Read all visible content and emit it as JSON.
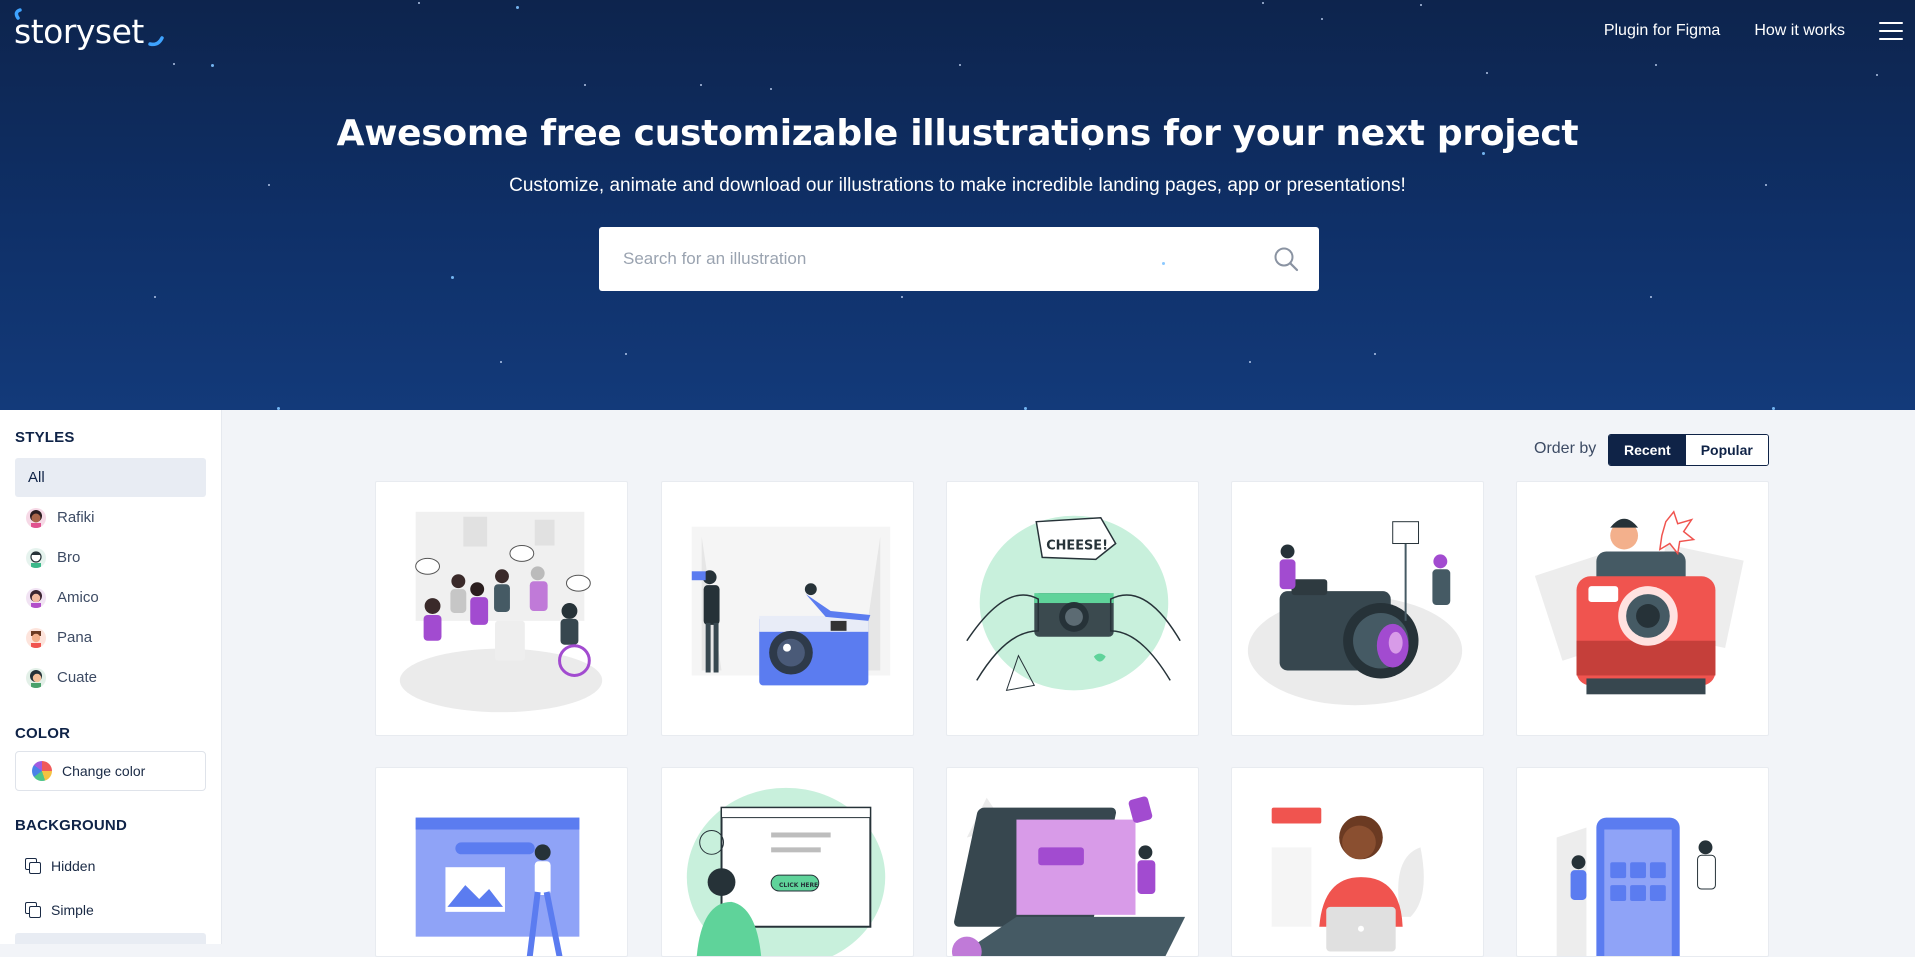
{
  "header": {
    "logo": "storyset",
    "nav": [
      "Plugin for Figma",
      "How it works"
    ]
  },
  "hero": {
    "title": "Awesome free customizable illustrations for your next project",
    "subtitle": "Customize, animate and download our illustrations to make incredible landing pages, app or presentations!",
    "search_placeholder": "Search for an illustration"
  },
  "sidebar": {
    "styles_title": "STYLES",
    "styles": [
      {
        "label": "All",
        "active": true
      },
      {
        "label": "Rafiki"
      },
      {
        "label": "Bro"
      },
      {
        "label": "Amico"
      },
      {
        "label": "Pana"
      },
      {
        "label": "Cuate"
      }
    ],
    "color_title": "COLOR",
    "change_color": "Change color",
    "background_title": "BACKGROUND",
    "backgrounds": [
      "Hidden",
      "Simple"
    ]
  },
  "order": {
    "label": "Order by",
    "options": [
      "Recent",
      "Popular"
    ],
    "selected": "Recent"
  },
  "cards": [
    {
      "name": "group-meeting-illustration"
    },
    {
      "name": "photographer-studio-illustration"
    },
    {
      "name": "cheese-camera-illustration"
    },
    {
      "name": "camera-photoshoot-illustration"
    },
    {
      "name": "instant-camera-illustration"
    },
    {
      "name": "click-here-presentation-illustration"
    },
    {
      "name": "click-here-browser-illustration"
    },
    {
      "name": "click-here-laptop-illustration"
    },
    {
      "name": "click-here-sign-illustration"
    },
    {
      "name": "mobile-app-illustration"
    }
  ],
  "card_labels": {
    "cheese": "CHEESE!",
    "click_here": "CLICK HERE"
  },
  "colors": {
    "hero_dark": "#0d244d",
    "accent_purple": "#a24bd0",
    "accent_blue": "#5b7cf0",
    "accent_green": "#5fd39a",
    "accent_red": "#f0544f"
  }
}
